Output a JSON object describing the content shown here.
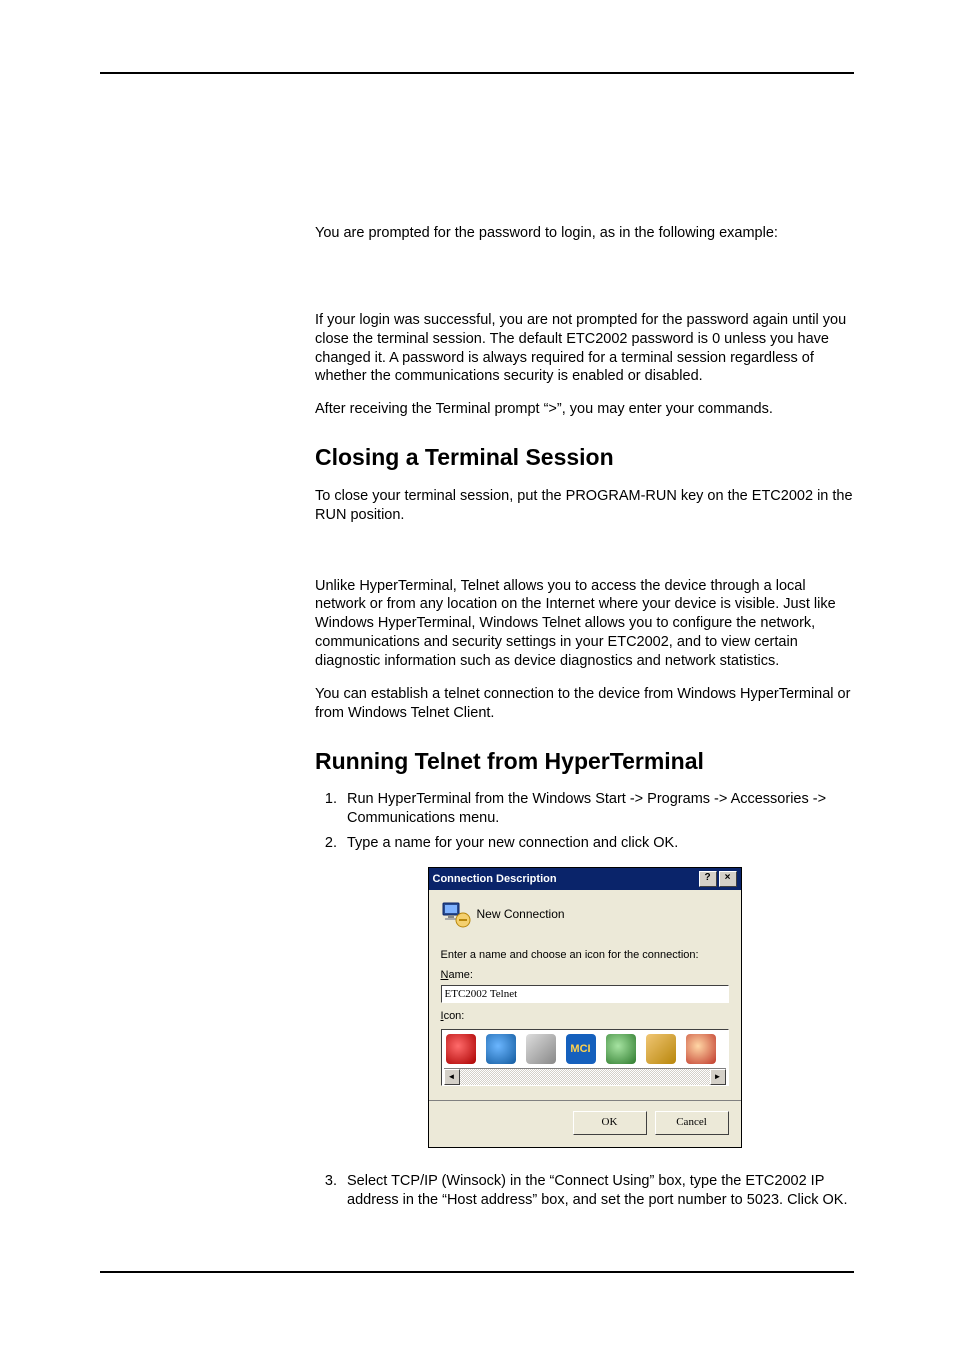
{
  "para1": "You are prompted for the password to login, as in the following example:",
  "para2": "If your login was successful, you are not prompted for the password again until you close the terminal session. The default ETC2002 password is 0 unless you have changed it. A password is always required for a terminal session regardless of whether the communications security is enabled or disabled.",
  "para3": "After receiving the Terminal prompt “>”, you may enter your commands.",
  "heading1": "Closing a Terminal Session",
  "para4": "To close your terminal session, put the PROGRAM-RUN key on the ETC2002 in the RUN position.",
  "para5": "Unlike HyperTerminal, Telnet allows you to access the device through a local network or from any location on the Internet where your device is visible. Just like Windows HyperTerminal, Windows Telnet allows you to configure the network, communications and security settings in your ETC2002, and to view certain diagnostic information such as device diagnostics and network statistics.",
  "para6": "You can establish a telnet connection to the device from Windows HyperTerminal or from Windows Telnet Client.",
  "heading2": "Running Telnet from HyperTerminal",
  "steps": {
    "s1": "Run HyperTerminal from the Windows Start -> Programs -> Accessories -> Communications menu.",
    "s2": "Type a name for your new connection and click OK.",
    "s3": "Select TCP/IP (Winsock) in the “Connect Using” box, type the ETC2002 IP address in the “Host address” box, and set the port number to 5023. Click OK."
  },
  "dialog": {
    "title": "Connection Description",
    "help": "?",
    "close": "×",
    "newconn": "New Connection",
    "instruction": "Enter a name and choose an icon for the connection:",
    "name_label_u": "N",
    "name_label_rest": "ame:",
    "name_value": "ETC2002 Telnet",
    "icon_label_u": "I",
    "icon_label_rest": "con:",
    "scroll_left": "◄",
    "scroll_right": "►",
    "ok": "OK",
    "cancel": "Cancel"
  }
}
